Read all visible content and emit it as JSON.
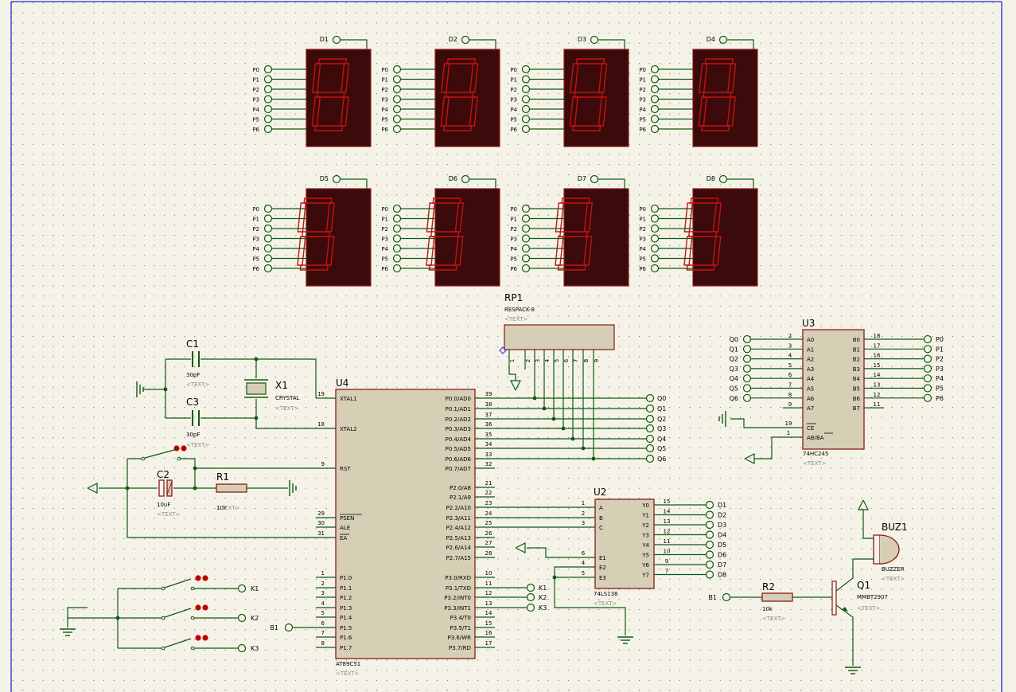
{
  "colors": {
    "background": "#f5f3e8",
    "grid_dot": "#5c5c4a",
    "border": "#2a2ad0",
    "wire": "#0e5a0e",
    "body_stroke": "#8a1a1a",
    "chip_fill": "#d6cfb5",
    "display_fill": "#3c0a0a",
    "segment": "#c41212",
    "text": "#000000",
    "placeholder_text": "#8c8c8c",
    "led_red": "#c00000"
  },
  "displays": {
    "top_labels": [
      "D1",
      "D2",
      "D3",
      "D4"
    ],
    "bottom_labels": [
      "D5",
      "D6",
      "D7",
      "D8"
    ],
    "segment_pins": [
      "P0",
      "P1",
      "P2",
      "P3",
      "P4",
      "P5",
      "P6"
    ]
  },
  "rp1": {
    "ref": "RP1",
    "value": "RESPACK-8",
    "text": "<TEXT>",
    "pins": [
      "1",
      "2",
      "3",
      "4",
      "5",
      "6",
      "7",
      "8",
      "9"
    ]
  },
  "u4": {
    "ref": "U4",
    "part": "AT89C51",
    "text": "<TEXT>",
    "left_pins": [
      {
        "num": "19",
        "name": "XTAL1"
      },
      {
        "num": "18",
        "name": "XTAL2"
      },
      {
        "num": "9",
        "name": "RST"
      },
      {
        "num": "29",
        "name": "PSEN"
      },
      {
        "num": "30",
        "name": "ALE"
      },
      {
        "num": "31",
        "name": "EA"
      },
      {
        "num": "1",
        "name": "P1.0"
      },
      {
        "num": "2",
        "name": "P1.1"
      },
      {
        "num": "3",
        "name": "P1.2"
      },
      {
        "num": "4",
        "name": "P1.3"
      },
      {
        "num": "5",
        "name": "P1.4"
      },
      {
        "num": "6",
        "name": "P1.5"
      },
      {
        "num": "7",
        "name": "P1.6"
      },
      {
        "num": "8",
        "name": "P1.7"
      }
    ],
    "right_pins": [
      {
        "num": "39",
        "name": "P0.0/AD0"
      },
      {
        "num": "38",
        "name": "P0.1/AD1"
      },
      {
        "num": "37",
        "name": "P0.2/AD2"
      },
      {
        "num": "36",
        "name": "P0.3/AD3"
      },
      {
        "num": "35",
        "name": "P0.4/AD4"
      },
      {
        "num": "34",
        "name": "P0.5/AD5"
      },
      {
        "num": "33",
        "name": "P0.6/AD6"
      },
      {
        "num": "32",
        "name": "P0.7/AD7"
      },
      {
        "num": "21",
        "name": "P2.0/A8"
      },
      {
        "num": "22",
        "name": "P2.1/A9"
      },
      {
        "num": "23",
        "name": "P2.2/A10"
      },
      {
        "num": "24",
        "name": "P2.3/A11"
      },
      {
        "num": "25",
        "name": "P2.4/A12"
      },
      {
        "num": "26",
        "name": "P2.5/A13"
      },
      {
        "num": "27",
        "name": "P2.6/A14"
      },
      {
        "num": "28",
        "name": "P2.7/A15"
      },
      {
        "num": "10",
        "name": "P3.0/RXD"
      },
      {
        "num": "11",
        "name": "P3.1/TXD"
      },
      {
        "num": "12",
        "name": "P3.2/INT0"
      },
      {
        "num": "13",
        "name": "P3.3/INT1"
      },
      {
        "num": "14",
        "name": "P3.4/T0"
      },
      {
        "num": "15",
        "name": "P3.5/T1"
      },
      {
        "num": "16",
        "name": "P3.6/WR"
      },
      {
        "num": "17",
        "name": "P3.7/RD"
      }
    ],
    "q_terminals": [
      "Q0",
      "Q1",
      "Q2",
      "Q3",
      "Q4",
      "Q5",
      "Q6"
    ],
    "k_terminals": [
      "K1",
      "K2",
      "K3"
    ],
    "b1_terminal": "B1"
  },
  "u2": {
    "ref": "U2",
    "part": "74LS138",
    "text": "<TEXT>",
    "left_pins": [
      {
        "num": "1",
        "name": "A"
      },
      {
        "num": "2",
        "name": "B"
      },
      {
        "num": "3",
        "name": "C"
      },
      {
        "num": "6",
        "name": "E1"
      },
      {
        "num": "4",
        "name": "E2"
      },
      {
        "num": "5",
        "name": "E3"
      }
    ],
    "right_pins": [
      {
        "num": "15",
        "name": "Y0",
        "net": "D1"
      },
      {
        "num": "14",
        "name": "Y1",
        "net": "D2"
      },
      {
        "num": "13",
        "name": "Y2",
        "net": "D3"
      },
      {
        "num": "12",
        "name": "Y3",
        "net": "D4"
      },
      {
        "num": "11",
        "name": "Y4",
        "net": "D5"
      },
      {
        "num": "10",
        "name": "Y5",
        "net": "D6"
      },
      {
        "num": "9",
        "name": "Y6",
        "net": "D7"
      },
      {
        "num": "7",
        "name": "Y7",
        "net": "D8"
      }
    ]
  },
  "u3": {
    "ref": "U3",
    "part": "74HC245",
    "text": "<TEXT>",
    "left_pins": [
      {
        "num": "2",
        "name": "A0",
        "net": "Q0"
      },
      {
        "num": "3",
        "name": "A1",
        "net": "Q1"
      },
      {
        "num": "4",
        "name": "A2",
        "net": "Q2"
      },
      {
        "num": "5",
        "name": "A3",
        "net": "Q3"
      },
      {
        "num": "6",
        "name": "A4",
        "net": "Q4"
      },
      {
        "num": "7",
        "name": "A5",
        "net": "Q5"
      },
      {
        "num": "8",
        "name": "A6",
        "net": "Q6"
      },
      {
        "num": "9",
        "name": "A7",
        "net": ""
      }
    ],
    "right_pins": [
      {
        "num": "18",
        "name": "B0",
        "net": "P0"
      },
      {
        "num": "17",
        "name": "B1",
        "net": "P1"
      },
      {
        "num": "16",
        "name": "B2",
        "net": "P2"
      },
      {
        "num": "15",
        "name": "B3",
        "net": "P3"
      },
      {
        "num": "14",
        "name": "B4",
        "net": "P4"
      },
      {
        "num": "13",
        "name": "B5",
        "net": "P5"
      },
      {
        "num": "12",
        "name": "B6",
        "net": "P6"
      },
      {
        "num": "11",
        "name": "B7",
        "net": ""
      }
    ],
    "ctrl_pins": [
      {
        "num": "19",
        "name": "CE"
      },
      {
        "num": "1",
        "name": "AB/BA"
      }
    ]
  },
  "passives": {
    "c1": {
      "ref": "C1",
      "value": "30pF",
      "text": "<TEXT>"
    },
    "c3": {
      "ref": "C3",
      "value": "30pF",
      "text": "<TEXT>"
    },
    "x1": {
      "ref": "X1",
      "value": "CRYSTAL",
      "text": "<TEXT>"
    },
    "c2": {
      "ref": "C2",
      "value": "10uF",
      "text": "<TEXT>"
    },
    "r1": {
      "ref": "R1",
      "value": "10k",
      "text": "<TEXT>"
    },
    "r2": {
      "ref": "R2",
      "value": "10k",
      "text": "<TEXT>"
    },
    "q1": {
      "ref": "Q1",
      "value": "MMBT2907",
      "text": "<TEXT>"
    },
    "buz1": {
      "ref": "BUZ1",
      "value": "BUZZER",
      "text": "<TEXT>"
    },
    "b1_net": "B1"
  }
}
